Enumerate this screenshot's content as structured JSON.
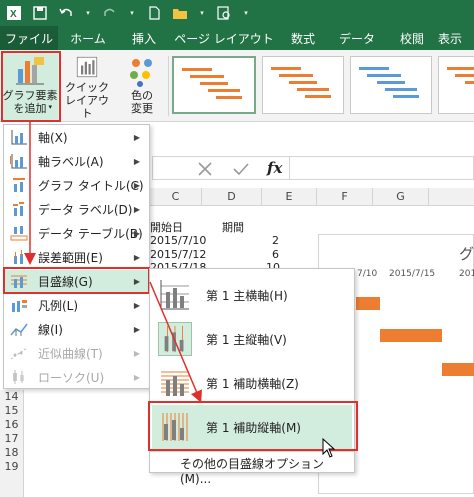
{
  "ribbon_tabs": [
    "ファイル",
    "ホーム",
    "挿入",
    "ページ レイアウト",
    "数式",
    "データ",
    "校閲",
    "表示"
  ],
  "ribbon": {
    "add_chart_element": "グラフ要素を追加",
    "add_chart_element_line1": "グラフ要素",
    "add_chart_element_line2": "を追加",
    "quick_layout_line1": "クイック",
    "quick_layout_line2": "レイアウト",
    "change_colors_line1": "色の",
    "change_colors_line2": "変更"
  },
  "formula_bar": {
    "fx": "fx"
  },
  "columns": [
    "C",
    "D",
    "E",
    "F",
    "G"
  ],
  "rows": [
    "14",
    "15",
    "16",
    "17",
    "18",
    "19"
  ],
  "cells": {
    "c_header": "開始日",
    "d_header": "期間",
    "c1": "2015/7/10",
    "d1": "2",
    "c2": "2015/7/12",
    "d2": "6",
    "c3": "2015/7/18",
    "d3": "10"
  },
  "chart": {
    "title_fragment": "グ",
    "axis_dates": [
      "7/10",
      "2015/7/15",
      "201"
    ]
  },
  "menu_items": [
    {
      "label": "軸(X)"
    },
    {
      "label": "軸ラベル(A)"
    },
    {
      "label": "グラフ タイトル(C)"
    },
    {
      "label": "データ ラベル(D)"
    },
    {
      "label": "データ テーブル(B)"
    },
    {
      "label": "誤差範囲(E)"
    },
    {
      "label": "目盛線(G)"
    },
    {
      "label": "凡例(L)"
    },
    {
      "label": "線(I)"
    },
    {
      "label": "近似曲線(T)"
    },
    {
      "label": "ローソク(U)"
    }
  ],
  "submenu_items": [
    {
      "label": "第 1 主横軸(H)"
    },
    {
      "label": "第 1 主縦軸(V)"
    },
    {
      "label": "第 1 補助横軸(Z)"
    },
    {
      "label": "第 1 補助縦軸(M)"
    }
  ],
  "submenu_footer": "その他の目盛線オプション(M)...",
  "colors": {
    "excel_green": "#217346",
    "highlight_red": "#e0302c",
    "bar_orange": "#ed7d31",
    "selected_bg": "#d2ecdd"
  }
}
